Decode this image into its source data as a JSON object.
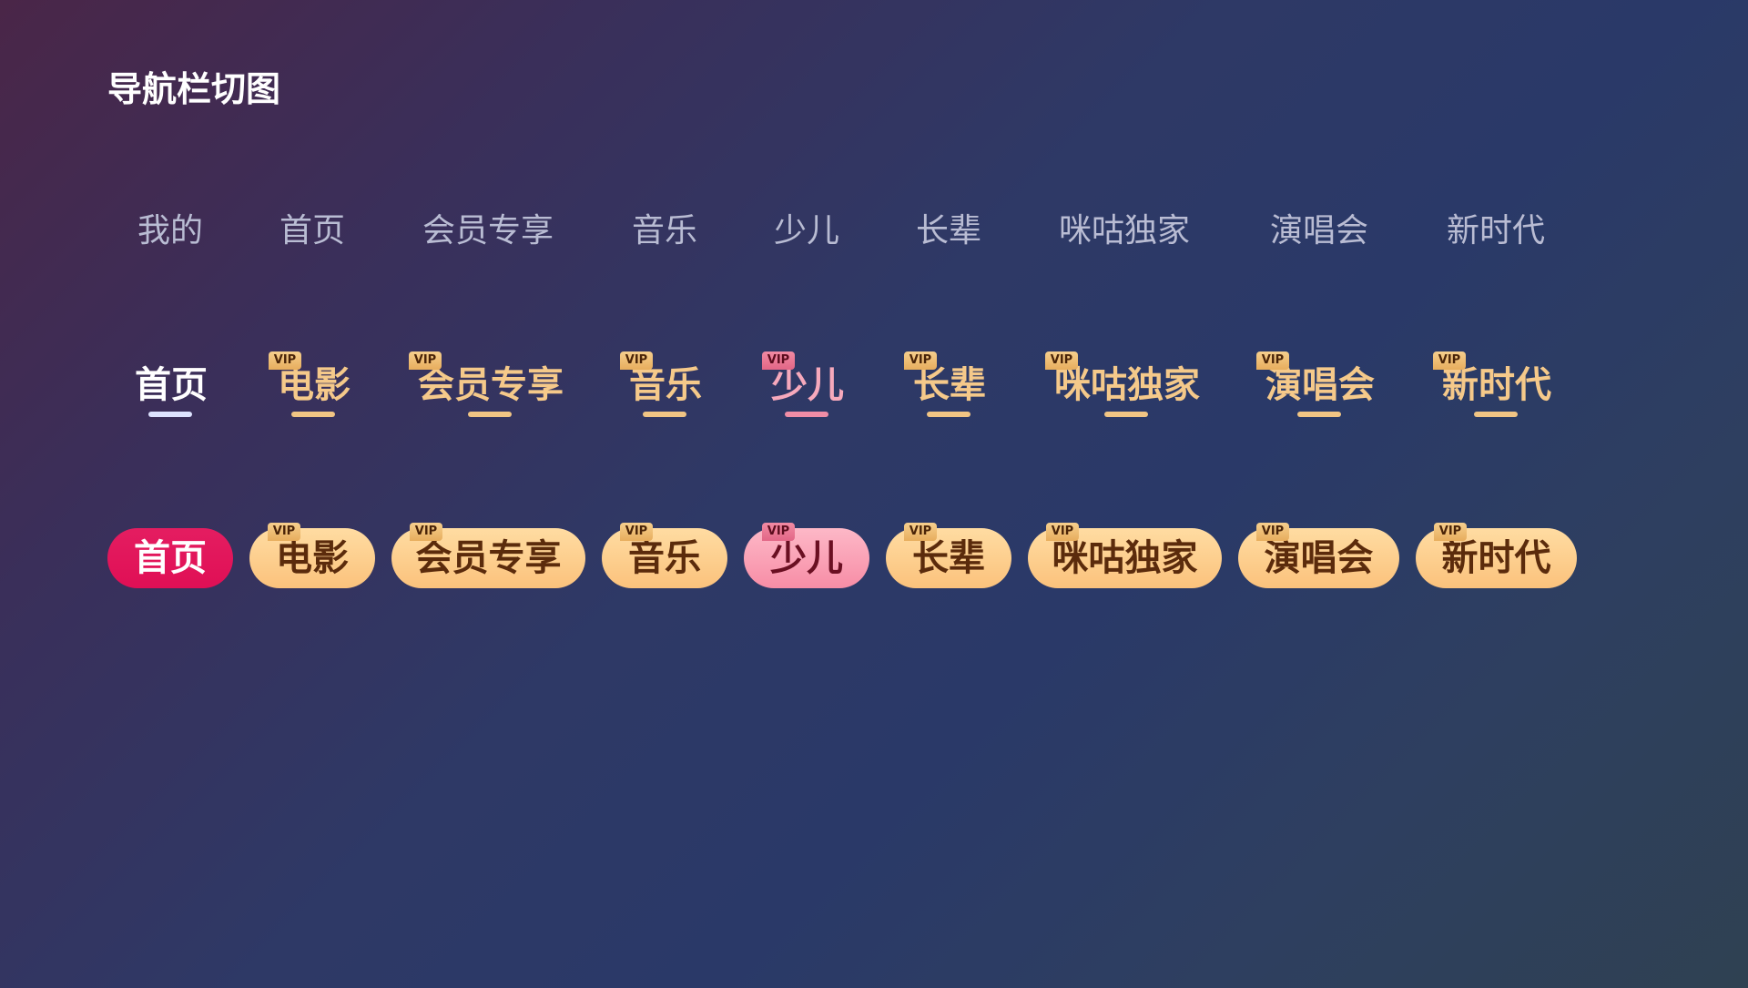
{
  "page": {
    "title": "导航栏切图"
  },
  "row1": {
    "items": [
      "我的",
      "首页",
      "会员专享",
      "音乐",
      "少儿",
      "长辈",
      "咪咕独家",
      "演唱会",
      "新时代"
    ]
  },
  "row2": {
    "items": [
      {
        "label": "首页",
        "vip": ""
      },
      {
        "label": "电影",
        "vip": "VIP"
      },
      {
        "label": "会员专享",
        "vip": "VIP"
      },
      {
        "label": "音乐",
        "vip": "VIP"
      },
      {
        "label": "少儿",
        "vip": "VIP"
      },
      {
        "label": "长辈",
        "vip": "VIP"
      },
      {
        "label": "咪咕独家",
        "vip": "VIP"
      },
      {
        "label": "演唱会",
        "vip": "VIP"
      },
      {
        "label": "新时代",
        "vip": "VIP"
      }
    ]
  },
  "row3": {
    "items": [
      {
        "label": "首页",
        "vip": ""
      },
      {
        "label": "电影",
        "vip": "VIP"
      },
      {
        "label": "会员专享",
        "vip": "VIP"
      },
      {
        "label": "音乐",
        "vip": "VIP"
      },
      {
        "label": "少儿",
        "vip": "VIP"
      },
      {
        "label": "长辈",
        "vip": "VIP"
      },
      {
        "label": "咪咕独家",
        "vip": "VIP"
      },
      {
        "label": "演唱会",
        "vip": "VIP"
      },
      {
        "label": "新时代",
        "vip": "VIP"
      }
    ]
  },
  "colors": {
    "active_pill": "#e0145a",
    "gold_pill": "#fbc27c",
    "pink_pill": "#f78da6",
    "gold_text": "#f5c98a",
    "muted_text": "#b9bcd3"
  }
}
